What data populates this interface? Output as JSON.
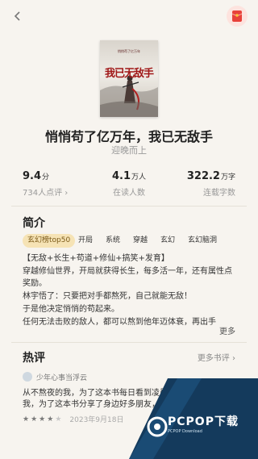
{
  "header": {
    "back_icon": "chevron-left-icon",
    "redpacket_icon": "red-packet-icon"
  },
  "cover": {
    "title": "我已无敌手",
    "subtitle": "悄悄苟了亿万年"
  },
  "book": {
    "title": "悄悄苟了亿万年，我已无敌手",
    "author": "迎晚而上"
  },
  "stats": [
    {
      "value": "9.4",
      "unit": "分",
      "label": "734人点评 ›"
    },
    {
      "value": "4.1",
      "unit": "万人",
      "label": "在读人数"
    },
    {
      "value": "322.2",
      "unit": "万字",
      "label": "连载字数"
    }
  ],
  "intro": {
    "title": "简介",
    "tags": [
      "玄幻榜top50",
      "开局",
      "系统",
      "穿越",
      "玄幻",
      "玄幻脑洞"
    ],
    "lines": [
      "【无敌+长生+苟道+修仙+搞笑+发育】",
      "穿越修仙世界，开局就获得长生，每多活一年，还有属性点",
      "奖励。",
      "林宇悟了：只要把对手都熬死，自己就能无敌！",
      "于是他决定悄悄的苟起来。",
      "任何无法击败的敌人，都可以熬到他年迈体衰，再出手"
    ],
    "more_label": "更多"
  },
  "reviews": {
    "title": "热评",
    "more_label": "更多书评 ›",
    "items": [
      {
        "user": "少年心事当浮云",
        "lines": [
          "从不熬夜的我，为了这本书每日看到凌晨，为",
          "我，为了这本书分享了身边好多朋友，之所以"
        ],
        "rating": 4,
        "date": "2023年9月18日"
      }
    ]
  },
  "watermark": {
    "text": "PCPOP下载",
    "sub": "PCPOP Download"
  },
  "colors": {
    "background": "#f7f4ef",
    "tag_highlight": "#f6e3b5",
    "redpacket": "#e8413a",
    "watermark_dark": "#143a5c"
  }
}
